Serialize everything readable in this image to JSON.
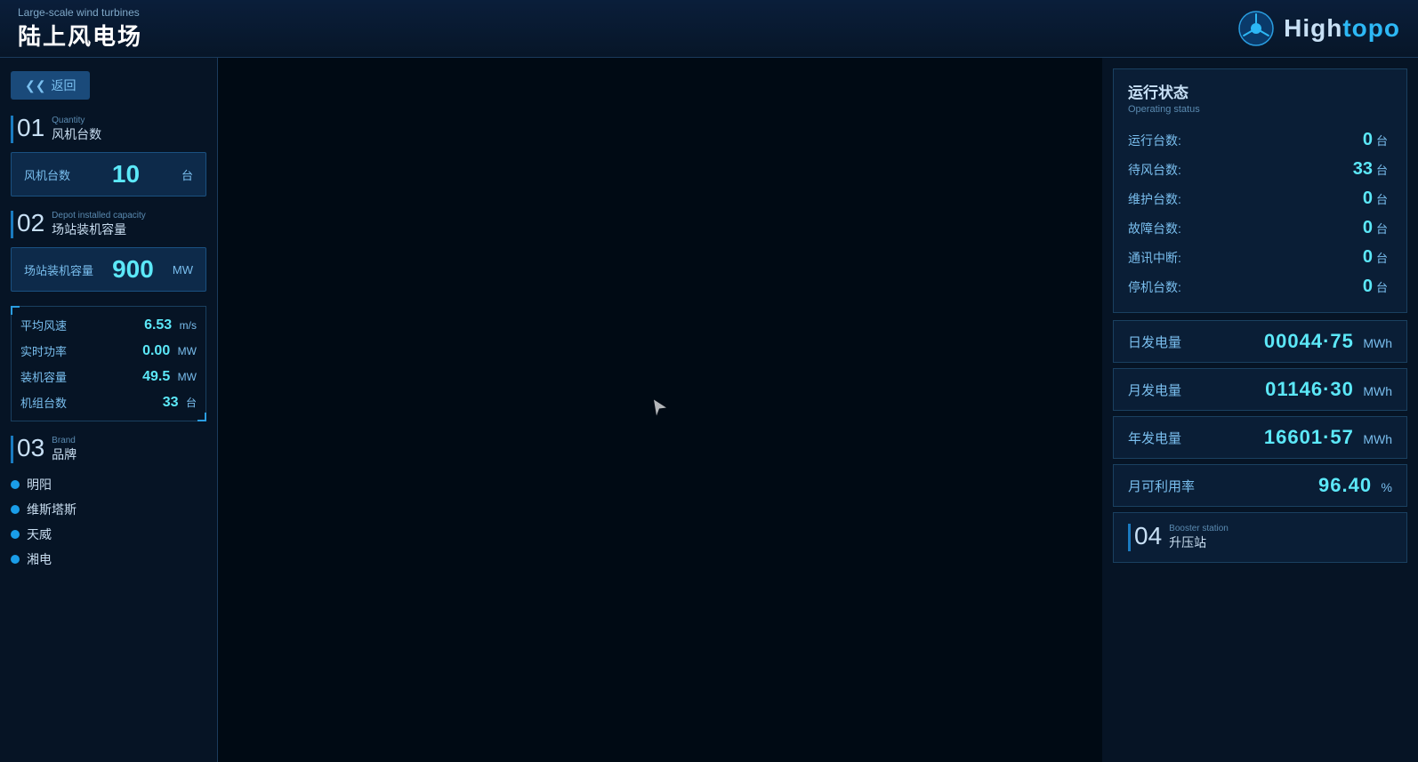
{
  "header": {
    "subtitle": "Large-scale wind turbines",
    "title": "陆上风电场",
    "logo_text_light": "High",
    "logo_text_bold": "topo"
  },
  "back_button": "返回",
  "section01": {
    "num": "01",
    "en": "Quantity",
    "cn": "风机台数",
    "stat_label": "风机台数",
    "stat_value": "10",
    "stat_unit": "台"
  },
  "section02": {
    "num": "02",
    "en": "Depot installed capacity",
    "cn": "场站装机容量",
    "stat_label": "场站装机容量",
    "stat_value": "900",
    "stat_unit": "MW"
  },
  "metrics": [
    {
      "label": "平均风速",
      "value": "6.53",
      "unit": "m/s"
    },
    {
      "label": "实时功率",
      "value": "0.00",
      "unit": "MW"
    },
    {
      "label": "装机容量",
      "value": "49.5",
      "unit": "MW"
    },
    {
      "label": "机组台数",
      "value": "33",
      "unit": "台"
    }
  ],
  "section03": {
    "num": "03",
    "en": "Brand",
    "cn": "品牌",
    "brands": [
      {
        "name": "明阳",
        "color": "#1a9de8"
      },
      {
        "name": "维斯塔斯",
        "color": "#1a9de8"
      },
      {
        "name": "天威",
        "color": "#1a9de8"
      },
      {
        "name": "湘电",
        "color": "#1a9de8"
      }
    ]
  },
  "op_status": {
    "title": "运行状态",
    "en": "Operating status",
    "rows": [
      {
        "label": "运行台数:",
        "value": "0",
        "unit": "台"
      },
      {
        "label": "待风台数:",
        "value": "33",
        "unit": "台"
      },
      {
        "label": "维护台数:",
        "value": "0",
        "unit": "台"
      },
      {
        "label": "故障台数:",
        "value": "0",
        "unit": "台"
      },
      {
        "label": "通讯中断:",
        "value": "0",
        "unit": "台"
      },
      {
        "label": "停机台数:",
        "value": "0",
        "unit": "台"
      }
    ]
  },
  "energy": [
    {
      "label": "日发电量",
      "value": "00044·75",
      "unit": "MWh"
    },
    {
      "label": "月发电量",
      "value": "01146·30",
      "unit": "MWh"
    },
    {
      "label": "年发电量",
      "value": "16601·57",
      "unit": "MWh"
    },
    {
      "label": "月可利用率",
      "value": "96.40",
      "unit": "%"
    }
  ],
  "section04": {
    "num": "04",
    "en": "Booster station",
    "cn": "升压站"
  }
}
